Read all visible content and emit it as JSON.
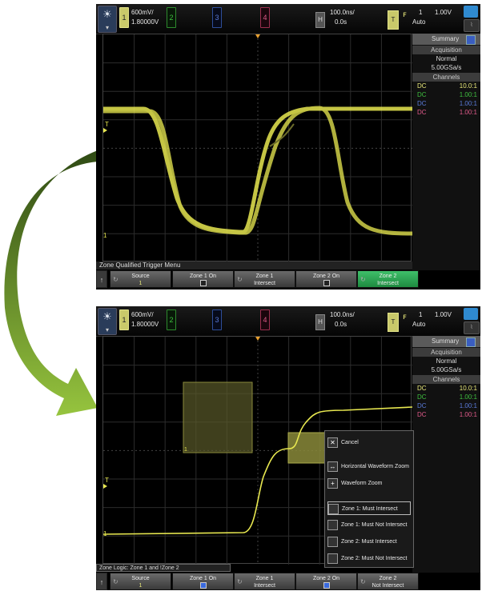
{
  "top_screen": {
    "ch1_scale": "600mV/",
    "ch1_offset": "1.80000V",
    "channels": [
      "1",
      "2",
      "3",
      "4"
    ],
    "time_scale": "100.0ns/",
    "time_delay": "0.0s",
    "h_label": "H",
    "t_label": "T",
    "trigger_channel": "1",
    "trigger_level": "1.00V",
    "trigger_mode": "Auto",
    "side_panel": {
      "title": "Summary",
      "acquisition_header": "Acquisition",
      "acquisition_mode": "Normal",
      "sample_rate": "5.00GSa/s",
      "channels_header": "Channels",
      "channel_rows": [
        {
          "coupling": "DC",
          "ratio": "10.0:1",
          "color": "#e8e87a"
        },
        {
          "coupling": "DC",
          "ratio": "1.00:1",
          "color": "#3fbf3f"
        },
        {
          "coupling": "DC",
          "ratio": "1.00:1",
          "color": "#5a7ad8"
        },
        {
          "coupling": "DC",
          "ratio": "1.00:1",
          "color": "#e05a8a"
        }
      ]
    },
    "menu_title": "Zone Qualified Trigger Menu",
    "softkeys": [
      {
        "label": "Source",
        "sub": "1"
      },
      {
        "label": "Zone 1 On",
        "sub": ""
      },
      {
        "label": "Zone 1",
        "sub": "Intersect"
      },
      {
        "label": "Zone 2 On",
        "sub": ""
      },
      {
        "label": "Zone 2",
        "sub": "Intersect"
      }
    ]
  },
  "bottom_screen": {
    "ch1_scale": "600mV/",
    "ch1_offset": "1.80000V",
    "channels": [
      "1",
      "2",
      "3",
      "4"
    ],
    "time_scale": "100.0ns/",
    "time_delay": "0.0s",
    "h_label": "H",
    "t_label": "T",
    "trigger_channel": "1",
    "trigger_level": "1.00V",
    "trigger_mode": "Auto",
    "side_panel": {
      "title": "Summary",
      "acquisition_header": "Acquisition",
      "acquisition_mode": "Normal",
      "sample_rate": "5.00GSa/s",
      "channels_header": "Channels",
      "channel_rows": [
        {
          "coupling": "DC",
          "ratio": "10.0:1",
          "color": "#e8e87a"
        },
        {
          "coupling": "DC",
          "ratio": "1.00:1",
          "color": "#3fbf3f"
        },
        {
          "coupling": "DC",
          "ratio": "1.00:1",
          "color": "#5a7ad8"
        },
        {
          "coupling": "DC",
          "ratio": "1.00:1",
          "color": "#e05a8a"
        }
      ]
    },
    "zone_logic": "Zone Logic: Zone 1 and !Zone 2",
    "context_menu": {
      "cancel": "Cancel",
      "horizontal_zoom": "Horizontal Waveform Zoom",
      "waveform_zoom": "Waveform Zoom",
      "items": [
        "Zone 1: Must Intersect",
        "Zone 1: Must Not Intersect",
        "Zone 2: Must Intersect",
        "Zone 2: Must Not Intersect"
      ]
    },
    "softkeys": [
      {
        "label": "Source",
        "sub": "1"
      },
      {
        "label": "Zone 1 On",
        "sub": ""
      },
      {
        "label": "Zone 1",
        "sub": "Intersect"
      },
      {
        "label": "Zone 2 On",
        "sub": ""
      },
      {
        "label": "Zone 2",
        "sub": "Not Intersect"
      }
    ]
  },
  "colors": {
    "trace": "#e8e850",
    "zone": "#8a8a3a",
    "arrow_dark": "#3d5a1a",
    "arrow_light": "#8ab83a"
  }
}
